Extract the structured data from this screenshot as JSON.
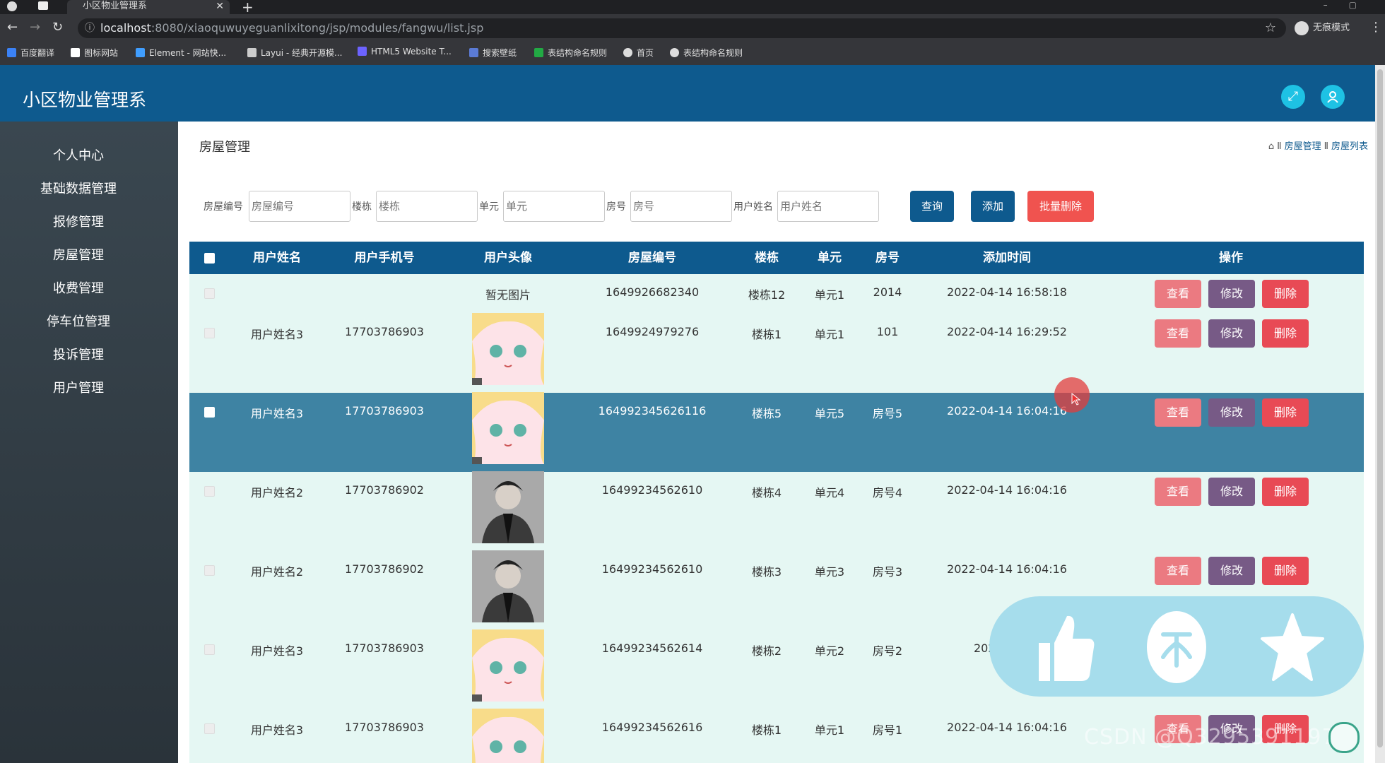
{
  "browser": {
    "tab_title": "小区物业管理系",
    "url_host": "localhost",
    "url_path": ":8080/xiaoquwuyeguanlixitong/jsp/modules/fangwu/list.jsp",
    "profile_label": "无痕模式",
    "bookmarks": [
      {
        "label": "百度翻译",
        "color": "#3b82f6"
      },
      {
        "label": "图标网站",
        "color": "#ffffff"
      },
      {
        "label": "Element - 网站快...",
        "color": "#409eff"
      },
      {
        "label": "Layui - 经典开源模...",
        "color": "#cccccc"
      },
      {
        "label": "HTML5 Website T...",
        "color": "#6c63ff"
      },
      {
        "label": "搜索壁纸",
        "color": "#5b7bd5"
      },
      {
        "label": "表结构命名规则",
        "color": "#22aa44"
      },
      {
        "label": "首页",
        "color": "#dddddd"
      },
      {
        "label": "表结构命名规则",
        "color": "#dddddd"
      }
    ]
  },
  "app": {
    "title": "小区物业管理系"
  },
  "sidebar": {
    "items": [
      {
        "label": "个人中心"
      },
      {
        "label": "基础数据管理"
      },
      {
        "label": "报修管理"
      },
      {
        "label": "房屋管理"
      },
      {
        "label": "收费管理"
      },
      {
        "label": "停车位管理"
      },
      {
        "label": "投诉管理"
      },
      {
        "label": "用户管理"
      }
    ]
  },
  "page": {
    "title": "房屋管理",
    "breadcrumb": [
      "房屋管理",
      "房屋列表"
    ]
  },
  "search": {
    "fields": [
      {
        "label": "房屋编号",
        "placeholder": "房屋编号"
      },
      {
        "label": "楼栋",
        "placeholder": "楼栋"
      },
      {
        "label": "单元",
        "placeholder": "单元"
      },
      {
        "label": "房号",
        "placeholder": "房号"
      },
      {
        "label": "用户姓名",
        "placeholder": "用户姓名"
      }
    ],
    "buttons": {
      "query": "查询",
      "add": "添加",
      "batch_delete": "批量删除"
    },
    "colors": {
      "query": "#0e5a8e",
      "add": "#0e5a8e",
      "batch_delete": "#f0534f"
    }
  },
  "table": {
    "columns": [
      "用户姓名",
      "用户手机号",
      "用户头像",
      "房屋编号",
      "楼栋",
      "单元",
      "房号",
      "添加时间",
      "操作"
    ],
    "action_labels": {
      "view": "查看",
      "edit": "修改",
      "delete": "删除"
    },
    "rows": [
      {
        "name": "",
        "phone": "",
        "avatar_text": "暂无图片",
        "avatar": "none",
        "house_no": "1649926682340",
        "building": "楼栋12",
        "unit": "单元1",
        "room": "2014",
        "time": "2022-04-14 16:58:18"
      },
      {
        "name": "用户姓名3",
        "phone": "17703786903",
        "avatar_text": "",
        "avatar": "anime",
        "house_no": "1649924979276",
        "building": "楼栋1",
        "unit": "单元1",
        "room": "101",
        "time": "2022-04-14 16:29:52"
      },
      {
        "name": "用户姓名3",
        "phone": "17703786903",
        "avatar_text": "",
        "avatar": "anime",
        "house_no": "164992345626116",
        "building": "楼栋5",
        "unit": "单元5",
        "room": "房号5",
        "time": "2022-04-14 16:04:16"
      },
      {
        "name": "用户姓名2",
        "phone": "17703786902",
        "avatar_text": "",
        "avatar": "male",
        "house_no": "16499234562610",
        "building": "楼栋4",
        "unit": "单元4",
        "room": "房号4",
        "time": "2022-04-14 16:04:16"
      },
      {
        "name": "用户姓名2",
        "phone": "17703786902",
        "avatar_text": "",
        "avatar": "male",
        "house_no": "16499234562610",
        "building": "楼栋3",
        "unit": "单元3",
        "room": "房号3",
        "time": "2022-04-14 16:04:16"
      },
      {
        "name": "用户姓名3",
        "phone": "17703786903",
        "avatar_text": "",
        "avatar": "anime",
        "house_no": "16499234562614",
        "building": "楼栋2",
        "unit": "单元2",
        "room": "房号2",
        "time": "2022-0"
      },
      {
        "name": "用户姓名3",
        "phone": "17703786903",
        "avatar_text": "",
        "avatar": "anime",
        "house_no": "16499234562616",
        "building": "楼栋1",
        "unit": "单元1",
        "room": "房号1",
        "time": "2022-04-14 16:04:16"
      }
    ],
    "highlight_row": 2
  },
  "watermark": "CSDN @Q3295391197",
  "theme": {
    "primary": "#0e5a8e",
    "row_bg": "#e5f7f3",
    "row_highlight": "#3e83a3",
    "view": "#eb7a81",
    "edit": "#775a86",
    "delete": "#e84a55"
  }
}
